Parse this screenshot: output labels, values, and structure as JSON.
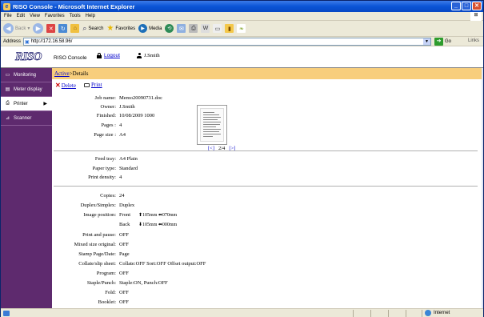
{
  "window": {
    "title": "RISO Console - Microsoft Internet Explorer"
  },
  "menu": [
    "File",
    "Edit",
    "View",
    "Favorites",
    "Tools",
    "Help"
  ],
  "toolbar": {
    "back": "Back",
    "search": "Search",
    "favorites": "Favorites",
    "media": "Media"
  },
  "address": {
    "label": "Address",
    "url": "http://172.16.58.96/",
    "go": "Go",
    "links": "Links"
  },
  "header": {
    "logo": "RISO",
    "console_label": "RISO Console",
    "logout": "Logout",
    "user": "J.Smith"
  },
  "sidebar": {
    "items": [
      {
        "label": "Monitoring",
        "icon": "monitor-icon"
      },
      {
        "label": "Meter display",
        "icon": "meter-icon"
      },
      {
        "label": "Printer",
        "icon": "printer-icon"
      },
      {
        "label": "Scanner",
        "icon": "scanner-icon"
      }
    ]
  },
  "breadcrumb": {
    "link": "Active",
    "separator": ">",
    "current": "Details"
  },
  "actions": {
    "delete": "Delete",
    "print": "Print"
  },
  "details": {
    "job_name": {
      "label": "Job name:",
      "value": "Memo20090731.doc"
    },
    "owner": {
      "label": "Owner:",
      "value": "J.Smith"
    },
    "finished": {
      "label": "Finished:",
      "value": "10/08/2009 1000"
    },
    "pages": {
      "label": "Pages :",
      "value": "4"
    },
    "page_size": {
      "label": "Page size :",
      "value": "A4"
    },
    "feed_tray": {
      "label": "Feed tray:",
      "value": "A4 Plain"
    },
    "paper_type": {
      "label": "Paper type:",
      "value": "Standard"
    },
    "print_density": {
      "label": "Print density:",
      "value": "4"
    },
    "copies": {
      "label": "Copies:",
      "value": "24"
    },
    "duplex": {
      "label": "Duplex/Simplex:",
      "value": "Duplex"
    },
    "image_position": {
      "label": "Image position:",
      "front_label": "Front",
      "front_value": "⬆105mm ⬌070mm",
      "back_label": "Back",
      "back_value": "⬇105mm ⬌000mm"
    },
    "print_pause": {
      "label": "Print and pause:",
      "value": "OFF"
    },
    "mixed_size": {
      "label": "Mixed size original:",
      "value": "OFF"
    },
    "stamp": {
      "label": "Stamp Page/Date:",
      "value": "Page"
    },
    "collate": {
      "label": "Collate/slip sheet:",
      "value": "Collate:OFF  Sort:OFF Offset output:OFF"
    },
    "program": {
      "label": "Program:",
      "value": "OFF"
    },
    "staple": {
      "label": "Staple/Punch:",
      "value": "Staple:ON, Punch:OFF"
    },
    "fold": {
      "label": "Fold:",
      "value": "OFF"
    },
    "booklet": {
      "label": "Booklet:",
      "value": "OFF"
    }
  },
  "preview": {
    "prev": "[<]",
    "page": "2/4",
    "next": "[>]"
  },
  "status": {
    "zone": "Internet"
  }
}
